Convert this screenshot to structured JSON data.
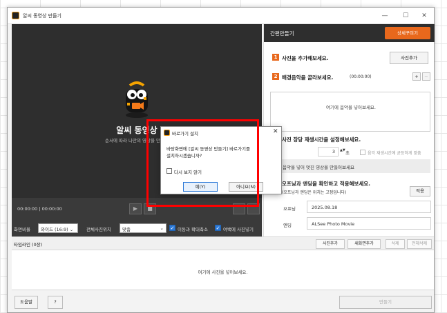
{
  "window": {
    "title": "알씨 동영상 만들기",
    "controls": {
      "minimize": "—",
      "maximize": "☐",
      "close": "✕"
    }
  },
  "preview": {
    "title": "알씨 동영상",
    "subtitle": "순서에 따라 나만의 영상을 만들어",
    "time_current": "00:00:00",
    "time_separator": "|",
    "time_total": "00:00:00",
    "play_icon": "▶",
    "stop_icon": "■"
  },
  "options": {
    "ratio_label": "화면비율",
    "ratio_value": "와이드 (16:9)",
    "position_label": "전체사진위치",
    "position_value": "맞춤",
    "check1_label": "이동과 확대축소",
    "check2_label": "여백에 사진넣기",
    "check_mark": "✓",
    "select_arrow": "⌄"
  },
  "right_panel": {
    "header": "간편만들기",
    "detail_button": "상세꾸미기",
    "step1_num": "1",
    "step1_label": "사진을 추가해보세요.",
    "add_photo_button": "사진추가",
    "step2_num": "2",
    "step2_label": "배경음악을 골라보세요.",
    "step2_time": "(00:00:00)",
    "plus": "+",
    "minus": "−",
    "music_hint": "여기에 음악을 넣어보세요.",
    "step3_label": "사진 장당 재생시간을 설정해보세요.",
    "seconds_value": "3",
    "seconds_unit": "초",
    "stepper_arrows": "▲▼",
    "sync_label": "음악 재생시간에 균등하게 맞춤",
    "gray_text": "시간 음악을 넣어 멋진 영상을 만들어보세요",
    "step4_label": "오프닝과 엔딩을 확인하고 적용해보세요.",
    "step4_note": "(오프닝과 엔딩은 위치는 고정입니다)",
    "apply_button": "적용",
    "opening_label": "오프닝",
    "opening_value": "2025.08.18",
    "ending_label": "엔딩",
    "ending_value": "ALSee Photo Movie"
  },
  "timeline": {
    "label": "타임라인 (0장)",
    "add_photo": "사진추가",
    "add_blank": "새화면추가",
    "delete": "삭제",
    "delete_all": "전체삭제",
    "hint": "여기에 사진을 넣어보세요."
  },
  "footer": {
    "help": "도움말",
    "question": "?",
    "make": "만들기"
  },
  "dialog": {
    "title": "바로가기 설치",
    "close": "✕",
    "message_line1": "바탕화면에 [알씨 동영상 만들기] 바로가기를",
    "message_line2": "설치하시겠습니까?",
    "dont_ask": "다시 보지 않기",
    "yes": "예(Y)",
    "no": "아니요(N)"
  },
  "colors": {
    "accent": "#e8681c",
    "highlight": "#ff0000",
    "dark_panel": "#2e2e2e"
  }
}
